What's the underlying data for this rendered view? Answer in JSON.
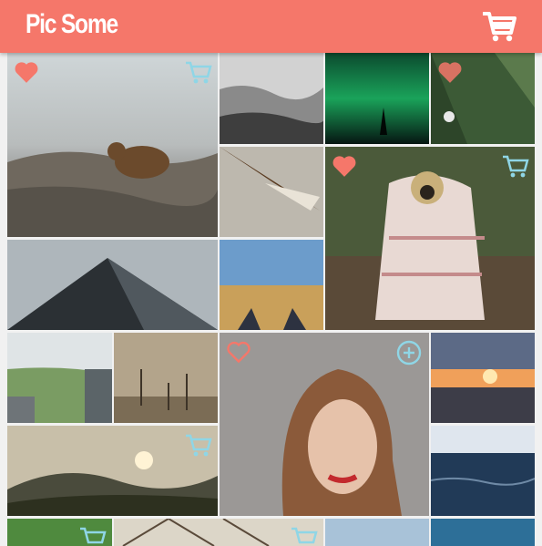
{
  "app": {
    "title": "Pic Some"
  },
  "colors": {
    "header": "#f5776a",
    "heart": "#f5776a",
    "cart": "#8fd6e6"
  },
  "icons": {
    "header_cart": "cart-icon",
    "favorite": "heart-icon",
    "add": "plus-circle-icon",
    "tile_cart": "cart-icon"
  }
}
